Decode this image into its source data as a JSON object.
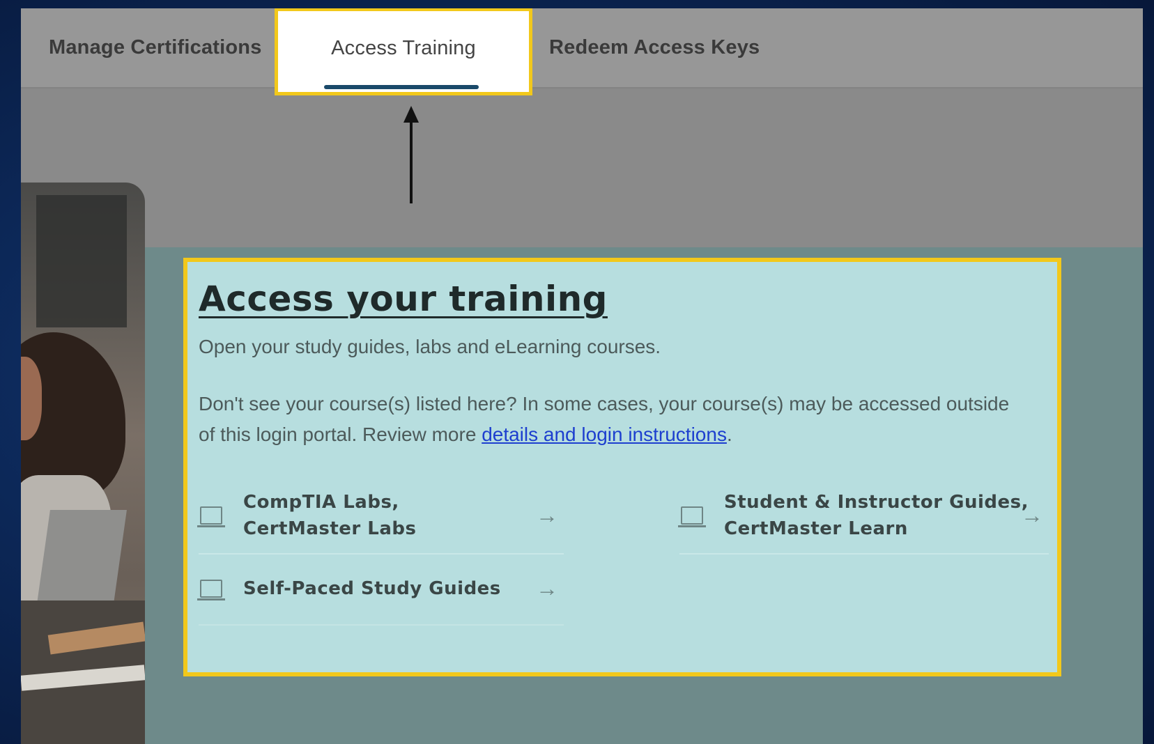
{
  "tabs": {
    "manage": "Manage Certifications",
    "access": "Access Training",
    "redeem": "Redeem Access Keys"
  },
  "card": {
    "title": "Access your training",
    "subtitle": "Open your study guides, labs and eLearning courses.",
    "para_before": "Don't see your course(s) listed here? In some cases, your course(s) may be accessed outside of this login portal. Review more ",
    "link": "details and login instructions",
    "para_after": "."
  },
  "courses": [
    {
      "label": "CompTIA Labs,\nCertMaster Labs",
      "icon": "laptop-icon"
    },
    {
      "label": "Self-Paced Study Guides",
      "icon": "laptop-icon"
    },
    {
      "label": "Student & Instructor Guides,\nCertMaster Learn",
      "icon": "laptop-icon"
    }
  ],
  "colors": {
    "highlight": "#f2c81b",
    "card_bg": "#b7dedf",
    "link": "#1d3fcf"
  }
}
